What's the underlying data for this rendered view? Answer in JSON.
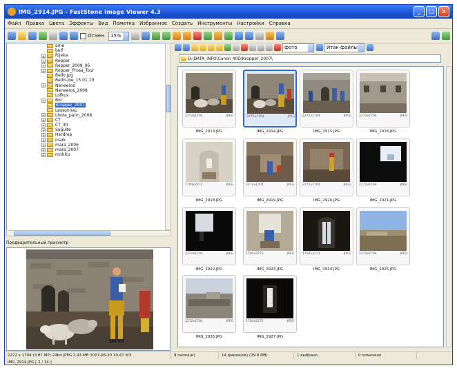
{
  "window": {
    "title": "IMG_2914.JPG - FastStone Image Viewer 4.3",
    "minimize": "_",
    "maximize": "□",
    "close": "×"
  },
  "menu": [
    "Файл",
    "Правка",
    "Цвета",
    "Эффекты",
    "Вид",
    "Пометка",
    "Избранное",
    "Создать",
    "Инструменты",
    "Настройки",
    "Справка"
  ],
  "toolbar": {
    "check_label": "Отмен.",
    "zoom_value": "15%",
    "view_value": "фото",
    "filter_value": "Итак файлы"
  },
  "tree": {
    "items": [
      {
        "label": "eme",
        "sel": false,
        "plus": false
      },
      {
        "label": "bolf",
        "sel": false,
        "plus": false
      },
      {
        "label": "Rijeka",
        "sel": false,
        "plus": true
      },
      {
        "label": "Ropper",
        "sel": false,
        "plus": true
      },
      {
        "label": "Ropper_2009_06",
        "sel": false,
        "plus": true
      },
      {
        "label": "Ropper_Prosa_Tour",
        "sel": false,
        "plus": true
      },
      {
        "label": "Bello.jpg",
        "sel": false,
        "plus": false
      },
      {
        "label": "Bello-Joe_15.01.10",
        "sel": false,
        "plus": false
      },
      {
        "label": "Neneeros",
        "sel": false,
        "plus": true
      },
      {
        "label": "Neneeros_2008",
        "sel": false,
        "plus": false
      },
      {
        "label": "Lofkus",
        "sel": false,
        "plus": false
      },
      {
        "label": "Bol",
        "sel": false,
        "plus": true
      },
      {
        "label": "Kropper_2007",
        "sel": true,
        "plus": false
      },
      {
        "label": "Lessonnau",
        "sel": false,
        "plus": false
      },
      {
        "label": "Lhota_pann_2008",
        "sel": false,
        "plus": true
      },
      {
        "label": "CT",
        "sel": false,
        "plus": true
      },
      {
        "label": "CT_30",
        "sel": false,
        "plus": true
      },
      {
        "label": "Sagulte",
        "sel": false,
        "plus": true
      },
      {
        "label": "Herdrop",
        "sel": false,
        "plus": true
      },
      {
        "label": "mark",
        "sel": false,
        "plus": true
      },
      {
        "label": "mara_2006",
        "sel": false,
        "plus": true
      },
      {
        "label": "mara_2007",
        "sel": false,
        "plus": true
      },
      {
        "label": "mohitu",
        "sel": false,
        "plus": true
      }
    ]
  },
  "preview": {
    "header": "Предварительный просмотр"
  },
  "content": {
    "path": "D:\\DATA_INFO\\Canon 40D\\Kropper_2007\\",
    "thumbs": [
      {
        "name": "IMG_2913.JPG",
        "dims": "2272x1704",
        "fmt": "JPEG",
        "scene": "pigs",
        "sel": false
      },
      {
        "name": "IMG_2914.JPG",
        "dims": "2272x1704",
        "fmt": "JPEG",
        "scene": "pigs2",
        "sel": true
      },
      {
        "name": "IMG_2915.JPG",
        "dims": "2272x1704",
        "fmt": "JPEG",
        "scene": "people",
        "sel": false
      },
      {
        "name": "IMG_2916.JPG",
        "dims": "2272x1704",
        "fmt": "JPEG",
        "scene": "wall",
        "sel": false
      },
      {
        "name": "IMG_2918.JPG",
        "dims": "1704x2272",
        "fmt": "JPEG",
        "scene": "chapel",
        "sel": false
      },
      {
        "name": "IMG_2919.JPG",
        "dims": "2272x1704",
        "fmt": "JPEG",
        "scene": "interior",
        "sel": false
      },
      {
        "name": "IMG_2920.JPG",
        "dims": "2272x1704",
        "fmt": "JPEG",
        "scene": "interior2",
        "sel": false
      },
      {
        "name": "IMG_2921.JPG",
        "dims": "2272x1704",
        "fmt": "JPEG",
        "scene": "dark",
        "sel": false
      },
      {
        "name": "IMG_2922.JPG",
        "dims": "2272x1704",
        "fmt": "JPEG",
        "scene": "dark2",
        "sel": false
      },
      {
        "name": "IMG_2923.JPG",
        "dims": "1704x2272",
        "fmt": "JPEG",
        "scene": "seated",
        "sel": false
      },
      {
        "name": "IMG_2924.JPG",
        "dims": "1704x2272",
        "fmt": "JPEG",
        "scene": "window",
        "sel": false
      },
      {
        "name": "IMG_2925.JPG",
        "dims": "2272x1704",
        "fmt": "JPEG",
        "scene": "landscape",
        "sel": false
      },
      {
        "name": "IMG_2926.JPG",
        "dims": "2272x1704",
        "fmt": "JPEG",
        "scene": "rooftop",
        "sel": false
      },
      {
        "name": "IMG_2927.JPG",
        "dims": "1704x2272",
        "fmt": "JPEG",
        "scene": "doorway",
        "sel": false
      }
    ]
  },
  "status": {
    "info": "2272 x 1704 (3.87 MP)  24bit JPEG  2.43 MB  2007-08-30 10:47 8/3",
    "folders": "8 папка(и)",
    "files": "14 файла(ов) (29.8 MB)",
    "selected": "1 выбрано",
    "marked": "0 помечено",
    "file_line": "IMG_2914.JPG [ 2 / 14 ]"
  }
}
